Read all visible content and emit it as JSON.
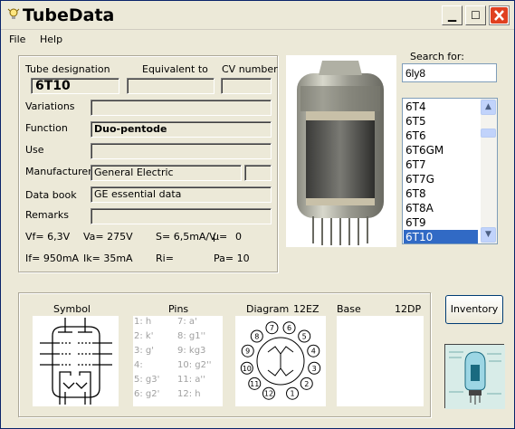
{
  "app": {
    "title": "TubeData"
  },
  "menu": {
    "file": "File",
    "help": "Help"
  },
  "header_labels": {
    "designation": "Tube designation",
    "equivalent": "Equivalent to",
    "cv": "CV number"
  },
  "tube": {
    "designation": "6T10",
    "equivalent": "",
    "cv_number": "",
    "variations": "",
    "function": "Duo-pentode",
    "use": "",
    "manufacturer": "General Electric",
    "manufacturer_extra": "",
    "data_book": "GE essential data",
    "remarks": ""
  },
  "labels": {
    "variations": "Variations",
    "function": "Function",
    "use": "Use",
    "manufacturer": "Manufacturer",
    "data_book": "Data book",
    "remarks": "Remarks"
  },
  "specs": {
    "vf": "Vf= 6,3V",
    "va": "Va= 275V",
    "s": "S= 6,5mA/V",
    "mu": "µ=",
    "mu_val": "0",
    "if": "If= 950mA",
    "ik": "Ik= 35mA",
    "ri": "Ri=",
    "pa": "Pa= 10"
  },
  "search": {
    "label": "Search for:",
    "value": "6ly8"
  },
  "tube_list": [
    "6T4",
    "6T5",
    "6T6",
    "6T6GM",
    "6T7",
    "6T7G",
    "6T8",
    "6T8A",
    "6T9",
    "6T10"
  ],
  "selected_index": 9,
  "bottom": {
    "symbol_label": "Symbol",
    "pins_label": "Pins",
    "diagram_label": "Diagram",
    "diagram_code": "12EZ",
    "base_label": "Base",
    "base_code": "12DP",
    "pins": [
      [
        "1: h",
        "7: a'"
      ],
      [
        "2: k'",
        "8: g1''"
      ],
      [
        "3: g'",
        "9: kg3"
      ],
      [
        "4:",
        "10: g2''"
      ],
      [
        "5: g3'",
        "11: a''"
      ],
      [
        "6: g2'",
        "12: h"
      ]
    ],
    "diagram_pins": [
      "1",
      "2",
      "3",
      "4",
      "5",
      "6",
      "7",
      "8",
      "9",
      "10",
      "11",
      "12"
    ]
  },
  "inventory_button": "Inventory",
  "colors": {
    "selection": "#316ac5",
    "close": "#e04020"
  }
}
